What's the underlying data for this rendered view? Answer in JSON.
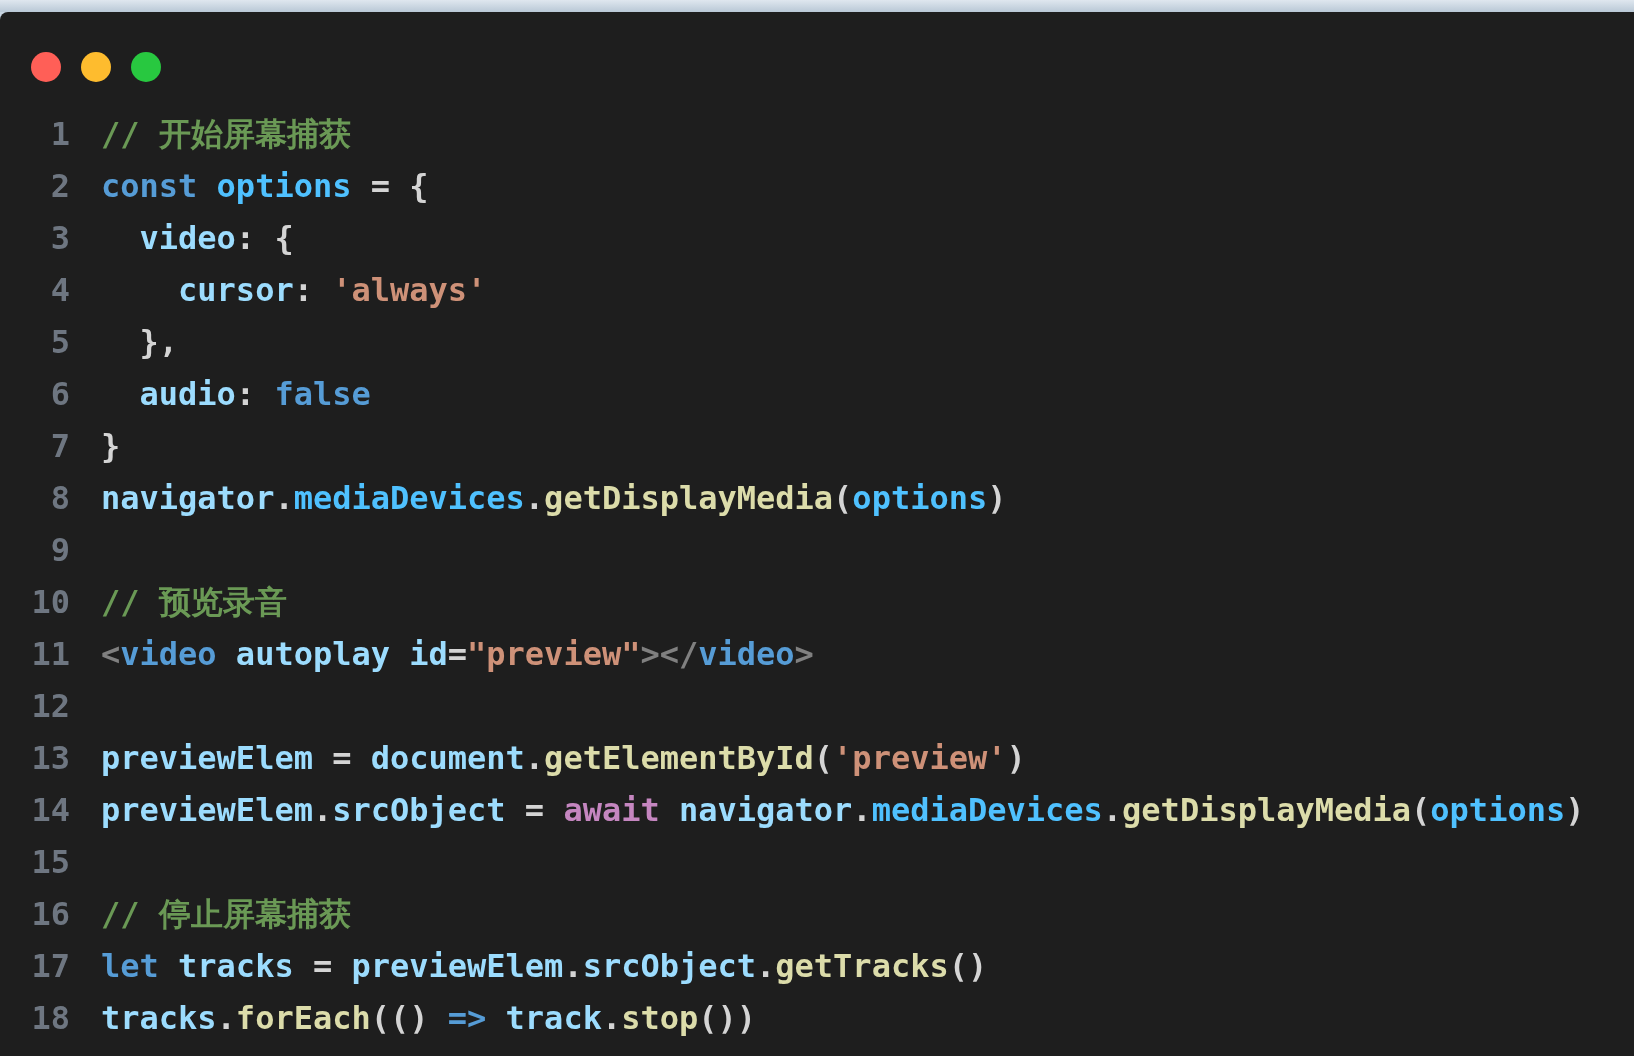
{
  "lines": [
    {
      "number": "1",
      "tokens": [
        {
          "kind": "comment",
          "text": "// 开始屏幕捕获"
        }
      ]
    },
    {
      "number": "2",
      "tokens": [
        {
          "kind": "keyword",
          "text": "const"
        },
        {
          "kind": "constant",
          "text": " options"
        },
        {
          "kind": "punct",
          "text": " = {"
        }
      ]
    },
    {
      "number": "3",
      "tokens": [
        {
          "kind": "variable",
          "text": "  video"
        },
        {
          "kind": "punct",
          "text": ": {"
        }
      ]
    },
    {
      "number": "4",
      "tokens": [
        {
          "kind": "variable",
          "text": "    cursor"
        },
        {
          "kind": "punct",
          "text": ": "
        },
        {
          "kind": "string",
          "text": "'always'"
        }
      ]
    },
    {
      "number": "5",
      "tokens": [
        {
          "kind": "punct",
          "text": "  },"
        }
      ]
    },
    {
      "number": "6",
      "tokens": [
        {
          "kind": "variable",
          "text": "  audio"
        },
        {
          "kind": "punct",
          "text": ": "
        },
        {
          "kind": "keyword",
          "text": "false"
        }
      ]
    },
    {
      "number": "7",
      "tokens": [
        {
          "kind": "punct",
          "text": "}"
        }
      ]
    },
    {
      "number": "8",
      "tokens": [
        {
          "kind": "variable",
          "text": "navigator"
        },
        {
          "kind": "punct",
          "text": "."
        },
        {
          "kind": "constant",
          "text": "mediaDevices"
        },
        {
          "kind": "punct",
          "text": "."
        },
        {
          "kind": "function",
          "text": "getDisplayMedia"
        },
        {
          "kind": "punct",
          "text": "("
        },
        {
          "kind": "constant",
          "text": "options"
        },
        {
          "kind": "punct",
          "text": ")"
        }
      ]
    },
    {
      "number": "9"
    },
    {
      "number": "10",
      "tokens": [
        {
          "kind": "comment",
          "text": "// 预览录音"
        }
      ]
    },
    {
      "number": "11",
      "tokens": [
        {
          "kind": "tag",
          "text": "<"
        },
        {
          "kind": "keyword",
          "text": "video"
        },
        {
          "kind": "variable",
          "text": " autoplay id"
        },
        {
          "kind": "punct",
          "text": "="
        },
        {
          "kind": "string",
          "text": "\"preview\""
        },
        {
          "kind": "tag",
          "text": "></"
        },
        {
          "kind": "keyword",
          "text": "video"
        },
        {
          "kind": "tag",
          "text": ">"
        }
      ]
    },
    {
      "number": "12"
    },
    {
      "number": "13",
      "tokens": [
        {
          "kind": "variable",
          "text": "previewElem"
        },
        {
          "kind": "punct",
          "text": " = "
        },
        {
          "kind": "variable",
          "text": "document"
        },
        {
          "kind": "punct",
          "text": "."
        },
        {
          "kind": "function",
          "text": "getElementById"
        },
        {
          "kind": "punct",
          "text": "("
        },
        {
          "kind": "string",
          "text": "'preview'"
        },
        {
          "kind": "punct",
          "text": ")"
        }
      ]
    },
    {
      "number": "14",
      "tokens": [
        {
          "kind": "variable",
          "text": "previewElem"
        },
        {
          "kind": "punct",
          "text": "."
        },
        {
          "kind": "variable",
          "text": "srcObject"
        },
        {
          "kind": "punct",
          "text": " = "
        },
        {
          "kind": "control",
          "text": "await"
        },
        {
          "kind": "variable",
          "text": " navigator"
        },
        {
          "kind": "punct",
          "text": "."
        },
        {
          "kind": "constant",
          "text": "mediaDevices"
        },
        {
          "kind": "punct",
          "text": "."
        },
        {
          "kind": "function",
          "text": "getDisplayMedia"
        },
        {
          "kind": "punct",
          "text": "("
        },
        {
          "kind": "constant",
          "text": "options"
        },
        {
          "kind": "punct",
          "text": ")"
        }
      ]
    },
    {
      "number": "15"
    },
    {
      "number": "16",
      "tokens": [
        {
          "kind": "comment",
          "text": "// 停止屏幕捕获"
        }
      ]
    },
    {
      "number": "17",
      "tokens": [
        {
          "kind": "keyword",
          "text": "let"
        },
        {
          "kind": "variable",
          "text": " tracks"
        },
        {
          "kind": "punct",
          "text": " = "
        },
        {
          "kind": "variable",
          "text": "previewElem"
        },
        {
          "kind": "punct",
          "text": "."
        },
        {
          "kind": "variable",
          "text": "srcObject"
        },
        {
          "kind": "punct",
          "text": "."
        },
        {
          "kind": "function",
          "text": "getTracks"
        },
        {
          "kind": "punct",
          "text": "()"
        }
      ]
    },
    {
      "number": "18",
      "tokens": [
        {
          "kind": "variable",
          "text": "tracks"
        },
        {
          "kind": "punct",
          "text": "."
        },
        {
          "kind": "function",
          "text": "forEach"
        },
        {
          "kind": "punct",
          "text": "(() "
        },
        {
          "kind": "keyword",
          "text": "=>"
        },
        {
          "kind": "variable",
          "text": " track"
        },
        {
          "kind": "punct",
          "text": "."
        },
        {
          "kind": "function",
          "text": "stop"
        },
        {
          "kind": "punct",
          "text": "())"
        }
      ]
    }
  ]
}
